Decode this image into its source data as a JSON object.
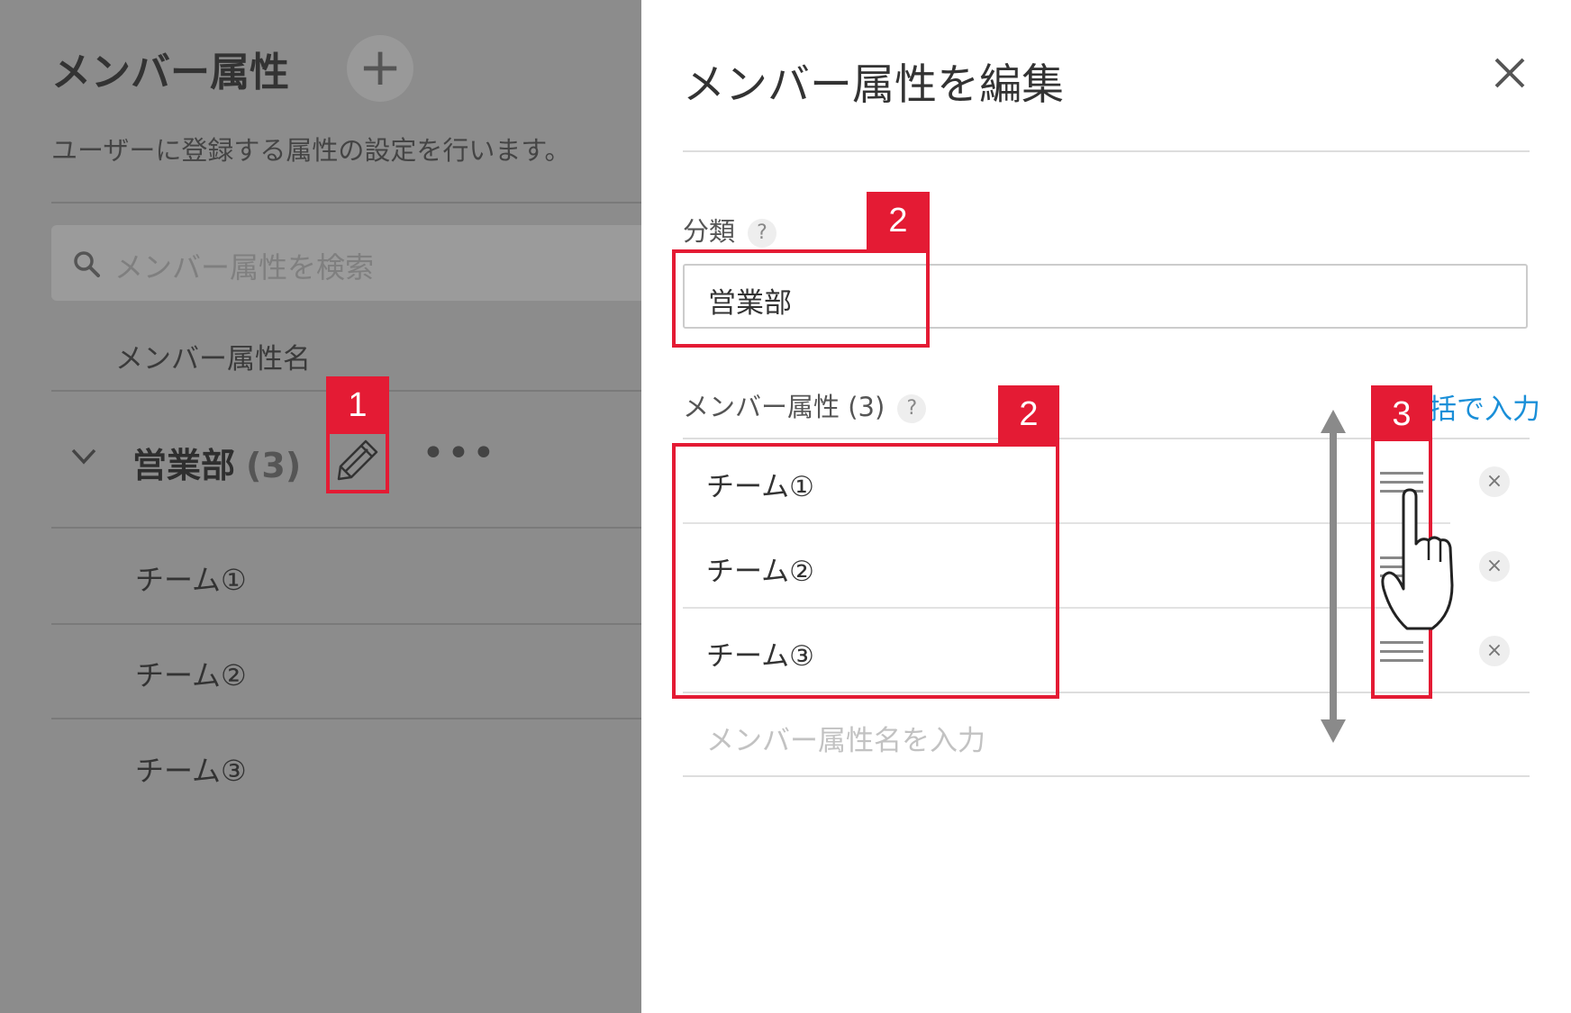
{
  "list_panel": {
    "title": "メンバー属性",
    "add_label": "+",
    "description": "ユーザーに登録する属性の設定を行います。",
    "search_placeholder": "メンバー属性を検索",
    "column_header": "メンバー属性名",
    "group": {
      "name": "営業部",
      "count": "(3)",
      "more_label": "•••"
    },
    "items": [
      "チーム①",
      "チーム②",
      "チーム③"
    ]
  },
  "edit_panel": {
    "title": "メンバー属性を編集",
    "close_label": "✕",
    "category_label": "分類",
    "help_label": "?",
    "category_value": "営業部",
    "attributes_label": "メンバー属性 (3)",
    "bulk_input_link": "括で入力",
    "attributes": [
      "チーム①",
      "チーム②",
      "チーム③"
    ],
    "remove_label": "×",
    "new_attribute_placeholder": "メンバー属性名を入力"
  },
  "annotations": {
    "badge_1": "1",
    "badge_2a": "2",
    "badge_2b": "2",
    "badge_3": "3"
  },
  "colors": {
    "accent_red": "#e41b34",
    "link_blue": "#1a8fd8",
    "overlay_gray": "#8c8c8c"
  }
}
